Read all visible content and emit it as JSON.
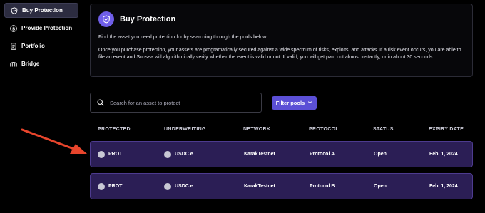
{
  "sidebar": {
    "items": [
      {
        "label": "Buy Protection",
        "icon": "shield-icon"
      },
      {
        "label": "Provide Protection",
        "icon": "dollar-icon"
      },
      {
        "label": "Portfolio",
        "icon": "document-icon"
      },
      {
        "label": "Bridge",
        "icon": "bridge-icon"
      }
    ]
  },
  "card": {
    "title": "Buy Protection",
    "para1": "Find the asset you need protection for by searching through the pools below.",
    "para2": "Once you purchase protection, your assets are programatically secured against a wide spectrum of risks, exploits, and attacks. If a risk event occurs, you are able to file an event and Subsea will algorithmically verify whether the event is valid or not. If valid, you will get paid out almost instantly, or in about 30 seconds."
  },
  "search": {
    "placeholder": "Search for an asset to protect",
    "value": ""
  },
  "filter": {
    "label": "Filter pools"
  },
  "table": {
    "headers": [
      "PROTECTED",
      "UNDERWRITING",
      "NETWORK",
      "PROTOCOL",
      "STATUS",
      "EXPIRY DATE"
    ],
    "rows": [
      {
        "protected": "PROT",
        "underwriting": "USDC.e",
        "network": "KarakTestnet",
        "protocol": "Protocol A",
        "status": "Open",
        "expiry": "Feb. 1, 2024"
      },
      {
        "protected": "PROT",
        "underwriting": "USDC.e",
        "network": "KarakTestnet",
        "protocol": "Protocol B",
        "status": "Open",
        "expiry": "Feb. 1, 2024"
      }
    ]
  },
  "colors": {
    "accent": "#6f5ee8",
    "row_bg": "#2b1e55",
    "arrow": "#e8452c"
  }
}
